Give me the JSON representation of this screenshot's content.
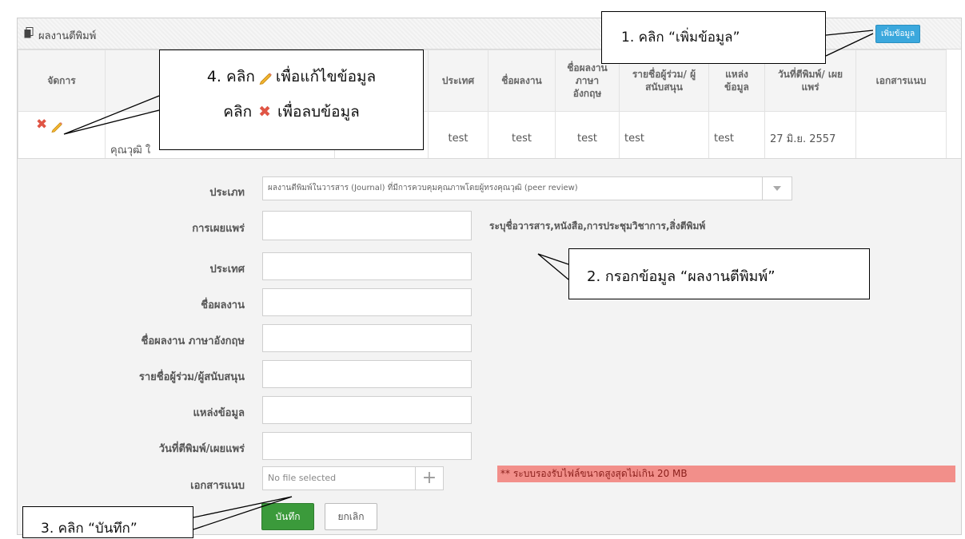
{
  "panel": {
    "title": "ผลงานตีพิมพ์",
    "add_label": "เพิ่มข้อมูล"
  },
  "table": {
    "headers": [
      "จัดการ",
      "",
      "",
      "ประเทศ",
      "ชื่อผลงาน",
      "ชื่อผลงาน ภาษา อังกฤษ",
      "รายชื่อผู้ร่วม/ ผู้สนับสนุน",
      "แหล่ง ข้อมูล",
      "วันที่ตีพิมพ์/ เผยแพร่",
      "เอกสารแนบ"
    ],
    "row": {
      "partial_text": "คุณวุฒิ ใ",
      "country": "test",
      "title": "test",
      "title_en": "test",
      "authors": "test",
      "source": "test",
      "date": "27 มิ.ย. 2557"
    }
  },
  "form": {
    "type_label": "ประเภท",
    "type_value": "ผลงานตีพิมพ์ในวารสาร (Journal) ที่มีการควบคุมคุณภาพโดยผู้ทรงคุณวุฒิ (peer review)",
    "publish_label": "การเผยแพร่",
    "publish_hint": "ระบุชื่อวารสาร,หนังสือ,การประชุมวิชาการ,สิ่งตีพิมพ์",
    "country_label": "ประเทศ",
    "title_label": "ชื่อผลงาน",
    "title_en_label": "ชื่อผลงาน ภาษาอังกฤษ",
    "authors_label": "รายชื่อผู้ร่วม/ผู้สนับสนุน",
    "source_label": "แหล่งข้อมูล",
    "date_label": "วันที่ตีพิมพ์/เผยแพร่",
    "attach_label": "เอกสารแนบ",
    "file_placeholder": "No file selected",
    "file_warning": "** ระบบรองรับไฟล์ขนาดสูงสุดไม่เกิน 20 MB",
    "save_label": "บันทึก",
    "cancel_label": "ยกเลิก"
  },
  "callouts": {
    "c1": "1. คลิก “เพิ่มข้อมูล”",
    "c2": "2. กรอกข้อมูล “ผลงานตีพิมพ์”",
    "c3": "3. คลิก “บันทึก”",
    "c4_line1_pre": "4. คลิก",
    "c4_line1_post": "เพื่อแก้ไขข้อมูล",
    "c4_line2_pre": "คลิก",
    "c4_line2_post": "เพื่อลบข้อมูล"
  },
  "icons": [
    "document-icon",
    "delete-icon",
    "edit-pencil-icon",
    "dropdown-arrow-icon",
    "add-file-icon"
  ],
  "colors": {
    "add_button": "#3ba8dd",
    "save_button": "#3b9a3b",
    "warning_bg": "#f28f8a",
    "delete_icon": "#e05545"
  }
}
